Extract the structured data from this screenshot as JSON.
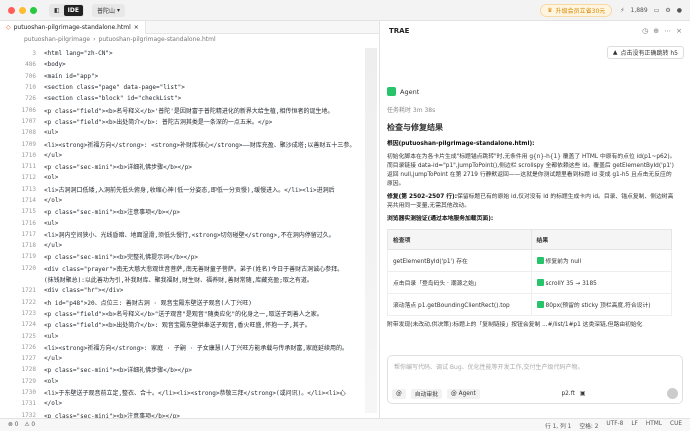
{
  "titlebar": {
    "ide_label": "IDE",
    "project": "普陀山",
    "upgrade": "升级会员立省30元",
    "count": "1,889",
    "colors": {
      "red": "#ff5f57",
      "yellow": "#febc2e",
      "green": "#28c840",
      "accent": "#27c46b"
    }
  },
  "editor": {
    "tab": "putuoshan-pilgrimage-standalone.html",
    "breadcrumb": [
      "putuoshan-pilgrimage",
      "putuoshan-pilgrimage-standalone.html"
    ],
    "lines": [
      {
        "n": "3",
        "t": "<html lang=\"zh-CN\">"
      },
      {
        "n": "486",
        "t": "<body>"
      },
      {
        "n": "706",
        "t": "<main id=\"app\">"
      },
      {
        "n": "710",
        "t": "  <section class=\"page\" data-page=\"list\">"
      },
      {
        "n": "726",
        "t": "    <section class=\"block\" id=\"checkList\">"
      },
      {
        "n": "1706",
        "t": "<p class=\"field\"><b>名号释义</b>'普陀'是因财富于普陀精进化的新界大给生植,相传恒者的诞生地。"
      },
      {
        "n": "1707",
        "t": "<p class=\"field\"><b>出处简介</b>: 普陀古洞其类是一条深的一点五米。</p>"
      },
      {
        "n": "1708",
        "t": "<ul>"
      },
      {
        "n": "1709",
        "t": "<li><strong>祈福方向</strong>: <strong>补财库核心</strong>——财库充盈、聚沙成塔;以善财五十三参。"
      },
      {
        "n": "1710",
        "t": "</ul>"
      },
      {
        "n": "1711",
        "t": "<p class=\"sec-mini\"><b>详细礼佛步骤</b></p>"
      },
      {
        "n": "1712",
        "t": "<ol>"
      },
      {
        "n": "1713",
        "t": "<li>古洞洞口低矮,入洞前先低头俯身,收缩心神(低一分姿态,即低一分贡慢),缓慢进入。</li><li>进洞后"
      },
      {
        "n": "1714",
        "t": "</ol>"
      },
      {
        "n": "1715",
        "t": "<p class=\"sec-mini\"><b>注意事项</b></p>"
      },
      {
        "n": "1716",
        "t": "<ul>"
      },
      {
        "n": "1717",
        "t": "<li>洞内空间狭小、光线昏暗、地面湿滑,须低头慢行,<strong>切勿碰壁</strong>,不在洞内停留过久。"
      },
      {
        "n": "1718",
        "t": "</ul>"
      },
      {
        "n": "1719",
        "t": "<p class=\"sec-mini\"><b>完整礼佛提示词</b></p>"
      },
      {
        "n": "1720",
        "t": "<div class=\"prayer\">南无大慈大悲观世音菩萨,南无善财童子菩萨。弟子(姓名)今日于善财古洞诚心参拜。"
      },
      {
        "n": "",
        "t": "(抹钱财聚总):以此善功为引,补我财库、聚我福财,财生财、福养财,善财常随,库藏充盈;取之有道。"
      },
      {
        "n": "1721",
        "t": "<div class=\"hr\"></div>"
      },
      {
        "n": "1722",
        "t": "<h id=\"p48\">20、点位三: 善财古洞 · 观音宝殿东壁送子观音(人丁兴旺)"
      },
      {
        "n": "1723",
        "t": "<p class=\"field\"><b>名号释义</b>\"送子观音\"是观音\"随类应化\"的化身之一,取送子到善人之家。"
      },
      {
        "n": "1724",
        "t": "<p class=\"field\"><b>出处简介</b>: 观音宝殿东壁供奉送子观音,香火旺盛,怀抱一子,其子。"
      },
      {
        "n": "1725",
        "t": "<ul>"
      },
      {
        "n": "1726",
        "t": "<li><strong>祈福方向</strong>: 家庭 · 子嗣 · 子女康慧(人丁兴旺方能承载与传承财富,家庭延续用的。"
      },
      {
        "n": "1727",
        "t": "</ul>"
      },
      {
        "n": "1728",
        "t": "<p class=\"sec-mini\"><b>详细礼佛步骤</b></p>"
      },
      {
        "n": "1729",
        "t": "<ol>"
      },
      {
        "n": "1730",
        "t": "<li>于东壁送子观音前立定,整衣、合十。</li><li><strong>恭敬三拜</strong>(或问讯)。</li><li>心"
      },
      {
        "n": "1731",
        "t": "</ol>"
      },
      {
        "n": "1732",
        "t": "<p class=\"sec-mini\"><b>注意事项</b></p>"
      },
      {
        "n": "1733",
        "t": "<ol>"
      },
      {
        "n": "1734",
        "t": "<li>本区香客多,请文明排队。</li>"
      }
    ]
  },
  "panel": {
    "title": "TRAE",
    "fix_chip": "点击没有正确跳转 h5",
    "agent_label": "Agent",
    "task_done": "任务耗时 3m 38s",
    "heading": "检查与修复结果",
    "root_cause": "根因(putuoshan-pilgrimage-standalone.html):",
    "root_detail": "初始化脚本在为各卡片生成\"标题锚点跳转\"时,无条件用 g{n}-h{1} 覆盖了 HTML 中原有的点位 id(p1~p62)。而目录链接 data-id=\"p1\",jumpToPoint(),侧边栏 scrollspy 全都依赖这些 id。覆盖后 getElementById('p1') 返回 null,jumpToPoint 在第 2719 行静默返回——这就是你测试题里看到标题 id 变成 g1-h5 且点击无反应的原因。",
    "fix_label": "修复(第 2502–2507 行):",
    "fix_detail": "保留标题已有的原始 id,仅对没有 id 的标题生成卡内 id。目录、锚点复制、侧边树高亮共用同一变量,无需其他改动。",
    "verify_label": "浏览器实测验证(通过本地服务加载页面):",
    "table_headers": [
      "检查项",
      "结果"
    ],
    "table_rows": [
      {
        "item": "getElementById('p1') 存在",
        "result": "修复前为 null"
      },
      {
        "item": "点击目录「登岛码头 · 潮源之始」",
        "result": "scrollY 35 → 3185"
      },
      {
        "item": "滚动落点 p1.getBoundingClientRect().top",
        "result": "80px(预留的 sticky 顶栏高度,符合设计)"
      }
    ],
    "note": "附带发现(未改动,供决策):标题上的「复制链接」按钮会复制 ...#/list/1#p1 这类深链,但路由初始化 parseRoute() 会丢弃 # 后面的锚点,所以通过分享进来的深链只会打开页面顶部。",
    "input_placeholder": "帮你编写代码、调试 Bug、优化性能等开发工作,交付生产级代码产物。",
    "input_chips": [
      "@",
      "自动审批",
      "@ Agent"
    ],
    "model": "p2.ft"
  },
  "status": {
    "left": [
      "⊗ 0",
      "⚠ 0"
    ],
    "right": [
      "行 1, 列 1",
      "空格: 2",
      "UTF-8",
      "LF",
      "HTML",
      "CUE"
    ]
  }
}
